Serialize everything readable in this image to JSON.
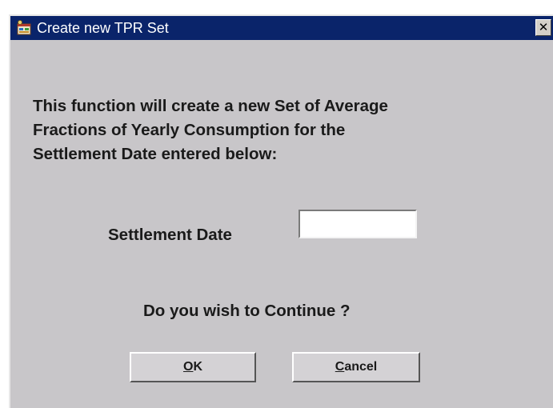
{
  "window": {
    "title": "Create new TPR Set",
    "close_glyph": "✕",
    "icon": "app-window-icon"
  },
  "message": {
    "line1": "This function will create a new Set of Average",
    "line2": "Fractions of Yearly Consumption for the",
    "line3": "Settlement Date entered below:"
  },
  "settlement_date": {
    "label": "Settlement Date",
    "value": ""
  },
  "prompt": {
    "text": "Do you wish to Continue ?"
  },
  "buttons": {
    "ok": {
      "mnemonic": "O",
      "rest": "K"
    },
    "cancel": {
      "mnemonic": "C",
      "rest": "ancel"
    }
  },
  "colors": {
    "titlebar": "#0a246a",
    "dialog_bg": "#c8c6c9",
    "text": "#1a1a1a"
  }
}
